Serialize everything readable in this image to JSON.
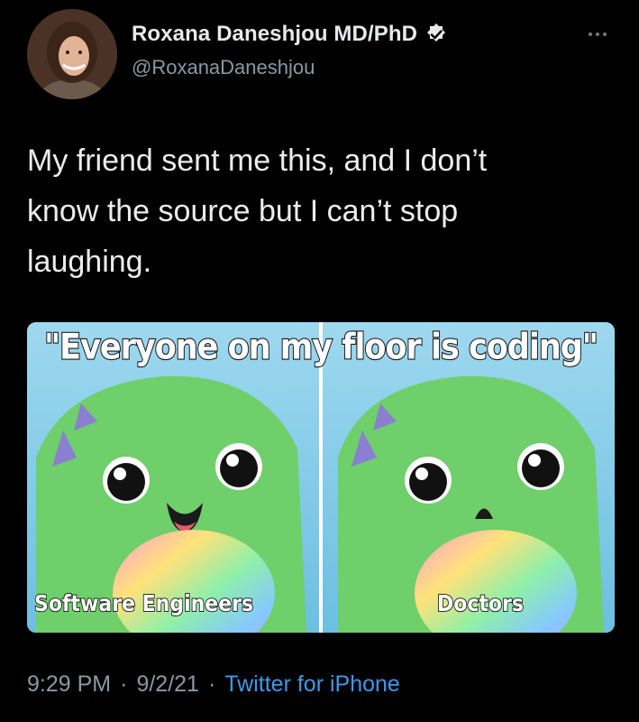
{
  "author": {
    "display_name": "Roxana Daneshjou MD/PhD",
    "handle": "@RoxanaDaneshjou",
    "avatar_icon": "profile-photo",
    "verified_icon": "verified-badge-icon"
  },
  "tweet": {
    "text": "My friend sent me this, and I don’t\nknow the source but I can’t stop\nlaughing."
  },
  "meme": {
    "caption": "\"Everyone on my floor is coding\"",
    "left_label": "Software Engineers",
    "right_label": "Doctors"
  },
  "meta": {
    "time": "9:29 PM",
    "separator": "·",
    "date": "9/2/21",
    "source": "Twitter for iPhone"
  },
  "colors": {
    "background": "#000000",
    "link": "#3b9be8",
    "secondary_text": "#8b98a5",
    "creature_green": "#6fcf6a"
  }
}
